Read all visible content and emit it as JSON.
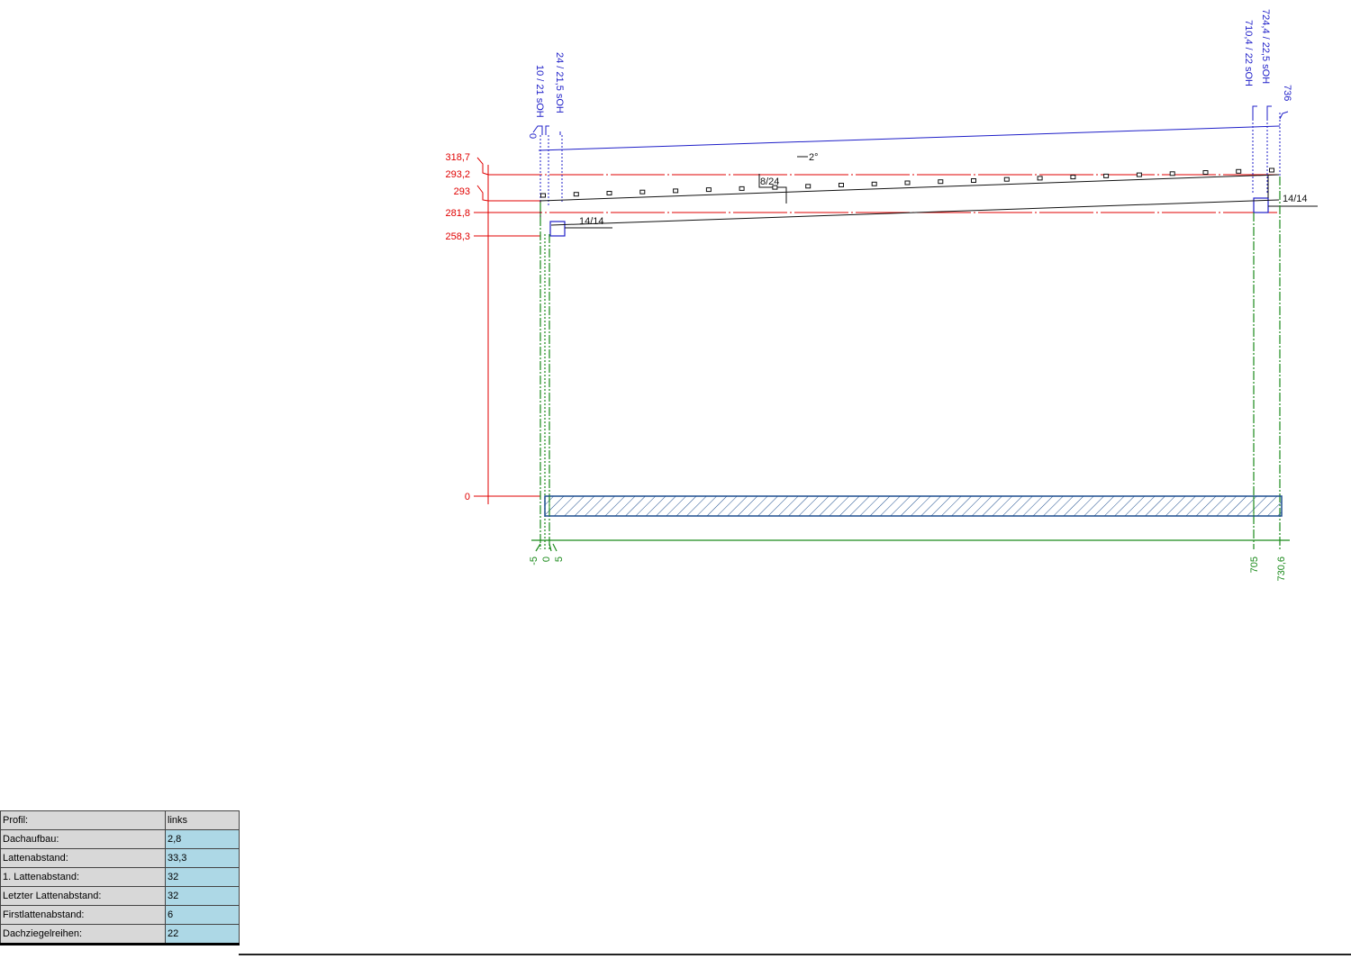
{
  "drawing": {
    "colors": {
      "red": "#e00000",
      "blue": "#1e1ec8",
      "green": "#1a8a1a",
      "black": "#111111",
      "hatch": "#1f4f8f"
    },
    "height_labels": [
      "318,7",
      "293,2",
      "293",
      "281,8",
      "258,3",
      "0"
    ],
    "top_labels": [
      "0",
      "10 / 21 sOH",
      "24 / 21,5 sOH",
      "710,4 / 22 sOH",
      "724,4 / 22,5 sOH",
      "736"
    ],
    "bottom_labels": [
      "-5",
      "0",
      "5",
      "705",
      "730,6"
    ],
    "angle_label": "2°",
    "purlin_left_label": "14/14",
    "purlin_right_label": "14/14",
    "rafter_label": "8/24"
  },
  "params": {
    "rows": [
      {
        "key": "Profil:",
        "value": "links"
      },
      {
        "key": "Dachaufbau:",
        "value": "2,8"
      },
      {
        "key": "Lattenabstand:",
        "value": "33,3"
      },
      {
        "key": "1. Lattenabstand:",
        "value": "32"
      },
      {
        "key": "Letzter Lattenabstand:",
        "value": "32"
      },
      {
        "key": "Firstlattenabstand:",
        "value": "6"
      },
      {
        "key": "Dachziegelreihen:",
        "value": "22"
      }
    ]
  }
}
